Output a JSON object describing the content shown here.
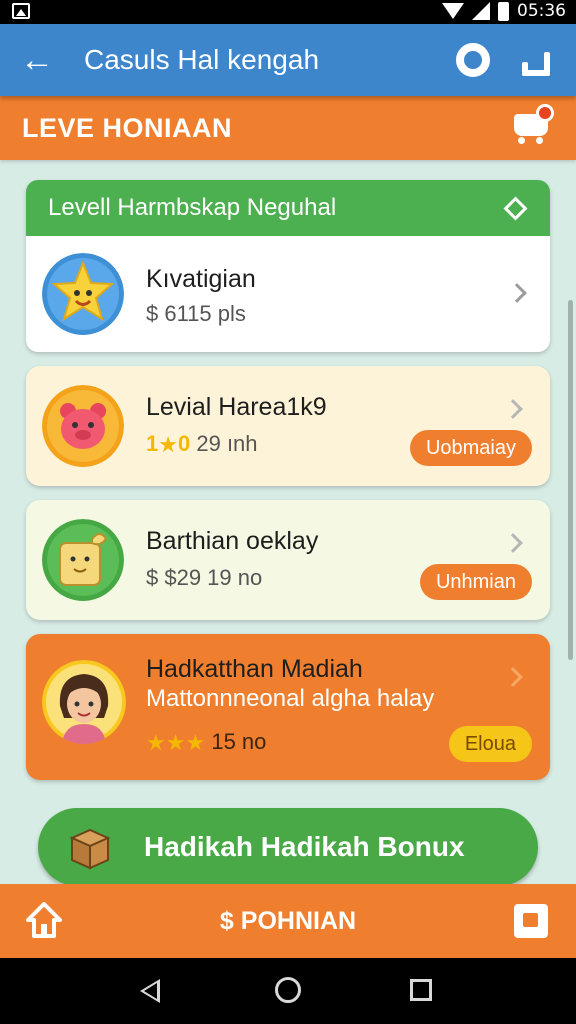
{
  "status_bar": {
    "time": "05:36"
  },
  "app_bar": {
    "title": "Casuls Hal kengah"
  },
  "level_bar": {
    "title": "LEVE HONIAAN"
  },
  "group": {
    "title": "Levell Harmbskap Neguhal",
    "item": {
      "name": "Kıvatigian",
      "price": "$ 6115 pls"
    }
  },
  "cards": [
    {
      "name": "Levial Harea1k9",
      "stars_text": "1",
      "stars_after": "0",
      "meta": "29 ınh",
      "pill": "Uobmaiay",
      "pill_color": "#ef7f2e",
      "bg": "#fdf3d8"
    },
    {
      "name": "Barthian oeklay",
      "meta": "$ $29 19 no",
      "pill": "Unhmian",
      "pill_color": "#ef7f2e",
      "bg": "#f5f8e3"
    },
    {
      "name": "Hadkatthan Madiah",
      "subtitle": "Mattonnneonal algha halay",
      "meta": "15 no",
      "pill": "Eloua",
      "pill_color": "#f5c518",
      "bg": "#ef7f2e"
    }
  ],
  "bonus_button": {
    "label": "Hadikah Hadikah Bonux"
  },
  "bottom_bar": {
    "label": "$ POHNIAN"
  },
  "colors": {
    "app_bar": "#3d86cc",
    "accent_orange": "#ef7f2e",
    "green": "#4caf50",
    "pill_yellow": "#f5c518"
  },
  "icons": [
    "back-arrow-icon",
    "record-circle-icon",
    "share-icon",
    "cart-icon",
    "diamond-icon",
    "chevron-right-icon",
    "star-icon",
    "box-icon",
    "home-icon",
    "nav-back-icon",
    "nav-home-icon",
    "nav-recent-icon"
  ]
}
